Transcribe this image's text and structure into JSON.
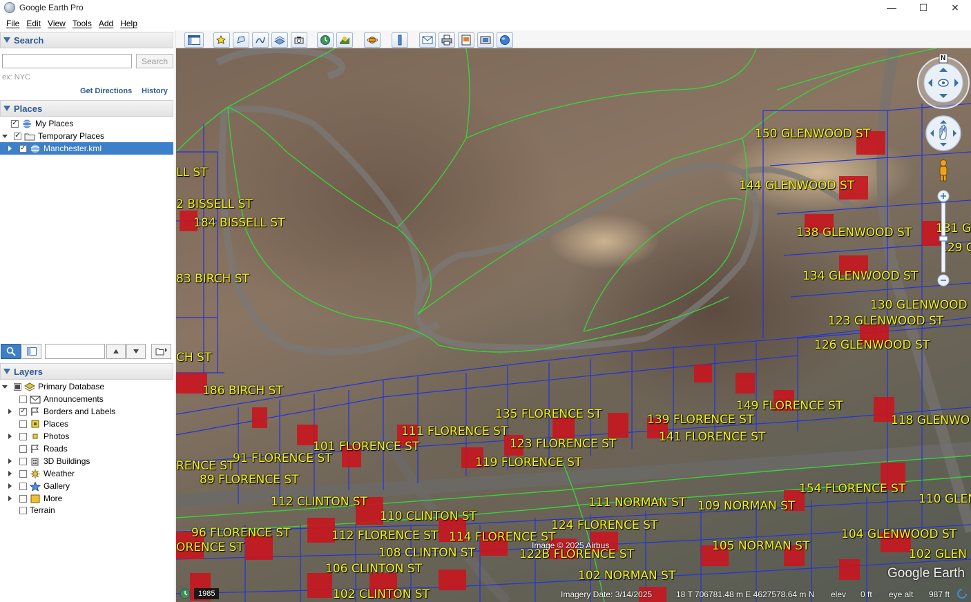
{
  "window": {
    "title": "Google Earth Pro",
    "controls": [
      "—",
      "☐",
      "✕"
    ]
  },
  "menu": [
    "File",
    "Edit",
    "View",
    "Tools",
    "Add",
    "Help"
  ],
  "search": {
    "header": "Search",
    "input_value": "",
    "button_label": "Search",
    "hint": "ex: NYC",
    "get_directions": "Get Directions",
    "history": "History"
  },
  "places": {
    "header": "Places",
    "items": [
      {
        "label": "My Places",
        "checked": true
      },
      {
        "label": "Temporary Places",
        "checked": true
      },
      {
        "label": "Manchester.kml",
        "checked": true,
        "selected": true
      }
    ]
  },
  "layers": {
    "header": "Layers",
    "items": [
      {
        "label": "Primary Database"
      },
      {
        "label": "Announcements"
      },
      {
        "label": "Borders and Labels",
        "checked": true
      },
      {
        "label": "Places"
      },
      {
        "label": "Photos"
      },
      {
        "label": "Roads"
      },
      {
        "label": "3D Buildings"
      },
      {
        "label": "Weather"
      },
      {
        "label": "Gallery"
      },
      {
        "label": "More"
      },
      {
        "label": "Terrain"
      }
    ]
  },
  "map": {
    "labels": [
      "150 GLENWOOD ST",
      "LL ST",
      "144 GLENWOOD ST",
      "2 BISSELL ST",
      "184 BISSELL ST",
      "138 GLENWOOD ST",
      "131 G",
      "129 G",
      "83 BIRCH ST",
      "134 GLENWOOD ST",
      "130 GLENWOOD",
      "123 GLENWOOD ST",
      "126 GLENWOOD ST",
      "CH ST",
      "186 BIRCH ST",
      "149 FLORENCE ST",
      "135 FLORENCE ST",
      "139 FLORENCE ST",
      "118 GLENWO",
      "111 FLORENCE ST",
      "141 FLORENCE ST",
      "123 FLORENCE ST",
      "101 FLORENCE ST",
      "91 FLORENCE ST",
      "RENCE ST",
      "119 FLORENCE ST",
      "89 FLORENCE ST",
      "154 FLORENCE ST",
      "110 GLENW",
      "112 CLINTON ST",
      "111 NORMAN ST",
      "109 NORMAN ST",
      "110 CLINTON ST",
      "124 FLORENCE ST",
      "96 FLORENCE ST",
      "112 FLORENCE ST",
      "114 FLORENCE ST",
      "104 GLENWOOD ST",
      "ORENCE ST",
      "105 NORMAN ST",
      "108 CLINTON ST",
      "122B FLORENCE ST",
      "102 GLEN",
      "106 CLINTON ST",
      "102 NORMAN ST",
      "102 CLINTON ST"
    ],
    "attribution": "Image © 2025 Airbus",
    "watermark": "Google Earth",
    "compass_north": "N"
  },
  "status": {
    "year": "1985",
    "imagery_date": "Imagery Date: 3/14/2025",
    "coords": "18 T 706781.48 m E 4627578.64 m N",
    "elev_label": "elev",
    "elev_value": "0 ft",
    "eye_alt_label": "eye alt",
    "eye_alt_value": "987 ft"
  }
}
